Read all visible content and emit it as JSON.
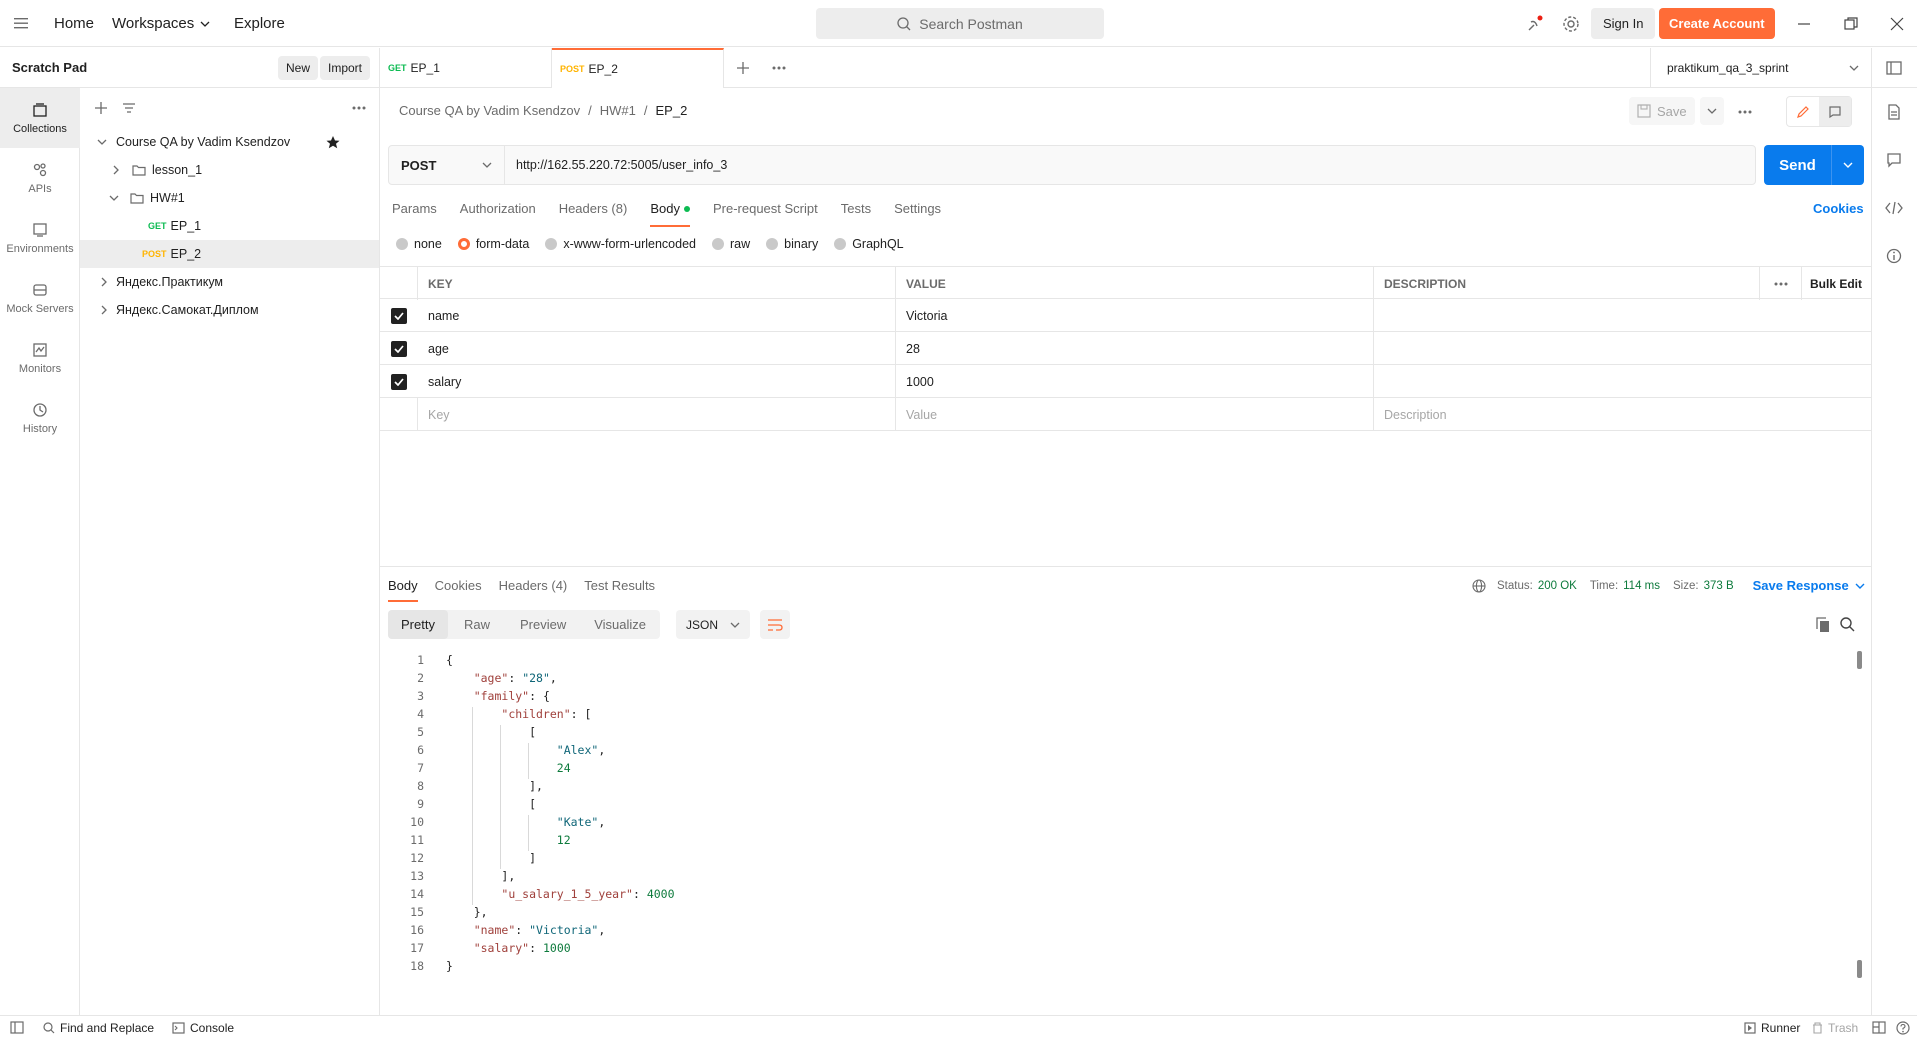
{
  "topbar": {
    "nav": [
      "Home",
      "Workspaces",
      "Explore"
    ],
    "search_placeholder": "Search Postman",
    "sign_in": "Sign In",
    "create_account": "Create Account"
  },
  "scratch": {
    "title": "Scratch Pad",
    "new": "New",
    "import": "Import"
  },
  "rail": [
    {
      "label": "Collections",
      "icon": "collections-icon"
    },
    {
      "label": "APIs",
      "icon": "apis-icon"
    },
    {
      "label": "Environments",
      "icon": "environments-icon"
    },
    {
      "label": "Mock Servers",
      "icon": "mock-servers-icon"
    },
    {
      "label": "Monitors",
      "icon": "monitors-icon"
    },
    {
      "label": "History",
      "icon": "history-icon"
    }
  ],
  "tree": {
    "collection": "Course QA by Vadim Ksendzov",
    "lesson": "lesson_1",
    "hw": "HW#1",
    "ep1_method": "GET",
    "ep1": "EP_1",
    "ep2_method": "POST",
    "ep2": "EP_2",
    "other1": "Яндекс.Практикум",
    "other2": "Яндекс.Самокат.Диплом"
  },
  "tabs": [
    {
      "method": "GET",
      "name": "EP_1"
    },
    {
      "method": "POST",
      "name": "EP_2"
    }
  ],
  "environment": "praktikum_qa_3_sprint",
  "breadcrumb": {
    "a": "Course QA by Vadim Ksendzov",
    "b": "HW#1",
    "c": "EP_2"
  },
  "save_label": "Save",
  "request": {
    "method": "POST",
    "url": "http://162.55.220.72:5005/user_info_3",
    "send": "Send"
  },
  "req_tabs": [
    "Params",
    "Authorization",
    "Headers (8)",
    "Body",
    "Pre-request Script",
    "Tests",
    "Settings"
  ],
  "cookies_link": "Cookies",
  "body_types": [
    "none",
    "form-data",
    "x-www-form-urlencoded",
    "raw",
    "binary",
    "GraphQL"
  ],
  "table": {
    "headers": [
      "KEY",
      "VALUE",
      "DESCRIPTION"
    ],
    "bulk_edit": "Bulk Edit",
    "rows": [
      {
        "key": "name",
        "value": "Victoria"
      },
      {
        "key": "age",
        "value": "28"
      },
      {
        "key": "salary",
        "value": "1000"
      }
    ],
    "placeholders": {
      "key": "Key",
      "value": "Value",
      "description": "Description"
    }
  },
  "response": {
    "tabs": [
      "Body",
      "Cookies",
      "Headers (4)",
      "Test Results"
    ],
    "status_label": "Status:",
    "status": "200 OK",
    "time_label": "Time:",
    "time": "114 ms",
    "size_label": "Size:",
    "size": "373 B",
    "save_response": "Save Response",
    "views": [
      "Pretty",
      "Raw",
      "Preview",
      "Visualize"
    ],
    "format": "JSON"
  },
  "code_lines": [
    "{",
    "    \"age\": \"28\",",
    "    \"family\": {",
    "        \"children\": [",
    "            [",
    "                \"Alex\",",
    "                24",
    "            ],",
    "            [",
    "                \"Kate\",",
    "                12",
    "            ]",
    "        ],",
    "        \"u_salary_1_5_year\": 4000",
    "    },",
    "    \"name\": \"Victoria\",",
    "    \"salary\": 1000",
    "}"
  ],
  "footer": {
    "find": "Find and Replace",
    "console": "Console",
    "runner": "Runner",
    "trash": "Trash"
  }
}
